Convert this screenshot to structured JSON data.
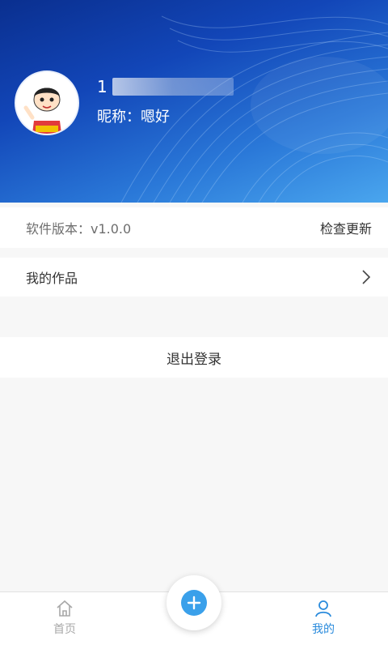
{
  "profile": {
    "id_visible": "1",
    "nickname": "昵称：嗯好"
  },
  "settings": {
    "version_label": "软件版本：v1.0.0",
    "check_update": "检查更新",
    "my_works": "我的作品",
    "logout": "退出登录"
  },
  "tabbar": {
    "home": "首页",
    "mine": "我的",
    "active_color": "#2a8bdc",
    "inactive_color": "#a8a8a8"
  },
  "icons": {
    "fab": "plus-icon",
    "home": "home-icon",
    "mine": "user-icon",
    "works": "chevron-right-icon"
  },
  "colors": {
    "header_gradient": [
      "#0a2f8f",
      "#4aa6ee"
    ],
    "fab_accent": "#3aa0ea"
  }
}
